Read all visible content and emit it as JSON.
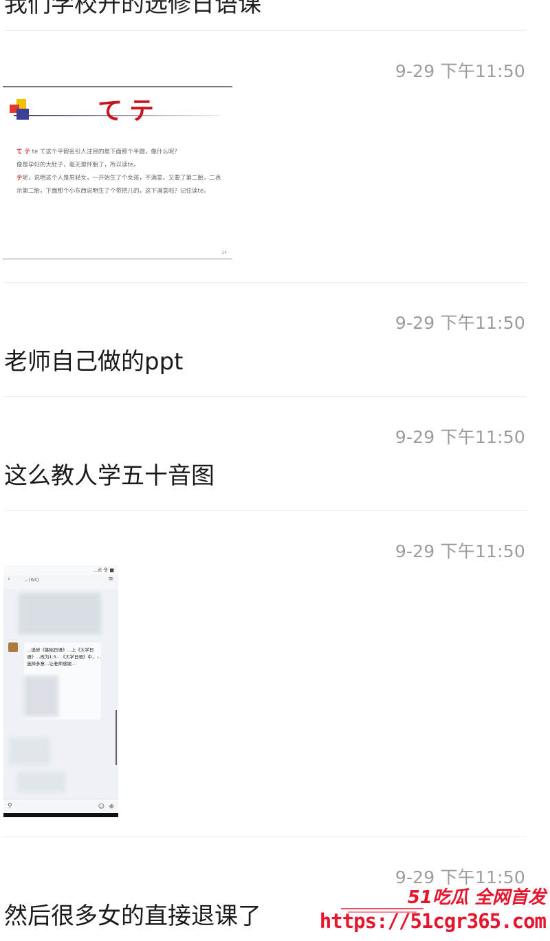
{
  "top_partial_text": "我们学校开的选修日语课",
  "messages": [
    {
      "time": "9-29 下午11:50",
      "type": "image"
    },
    {
      "time": "9-29 下午11:50",
      "type": "text",
      "text": "老师自己做的ppt"
    },
    {
      "time": "9-29 下午11:50",
      "type": "text",
      "text": "这么教人学五十音图"
    },
    {
      "time": "9-29 下午11:50",
      "type": "image"
    },
    {
      "time": "9-29 下午11:50",
      "type": "text",
      "text": "然后很多女的直接退课了"
    }
  ],
  "slide": {
    "title": "てテ",
    "line1_hl": "て テ",
    "line1": " te て这个平假名引人注目的是下面那个半圆，像什么呢？",
    "line2": "像是孕妇的大肚子，毫无是怀胎了，所以读te。",
    "line3_hl": "テ",
    "line3": "呢，说明这个人是男轻女，一开始生了个女孩，不满意，又要了第二胎，二表示第二胎，下面那个小东西说明生了个带把儿的，这下满意啦？记住读te。",
    "page": "24"
  },
  "phone": {
    "status": "…ıll 令 ■",
    "title": "…(64)",
    "bubble": "…选修《基础日语》…上《大学日语》…改为1.5…《大学日语》中，…选择多意…让老师感谢…"
  },
  "watermark": {
    "brand": "51吃瓜 全网首发",
    "url": "https://51cgr365.com"
  },
  "colors": {
    "timestamp": "#9c9c9c",
    "kana_red": "#c8141c",
    "watermark_red": "#e8142b"
  }
}
